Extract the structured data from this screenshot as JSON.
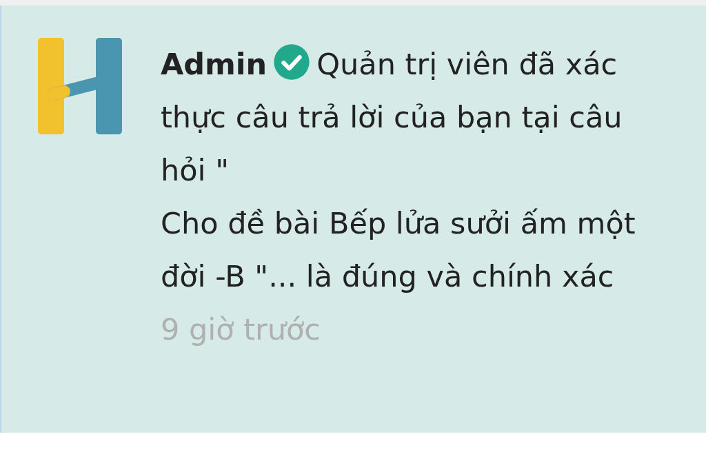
{
  "notification": {
    "sender": "Admin",
    "verified": true,
    "message": "Quản trị viên đã xác thực câu trả lời của bạn tại câu hỏi \"\nCho đề bài Bếp lửa sưởi ấm một đời -B \"... là đúng và chính xác",
    "time": "9 giờ trước"
  }
}
